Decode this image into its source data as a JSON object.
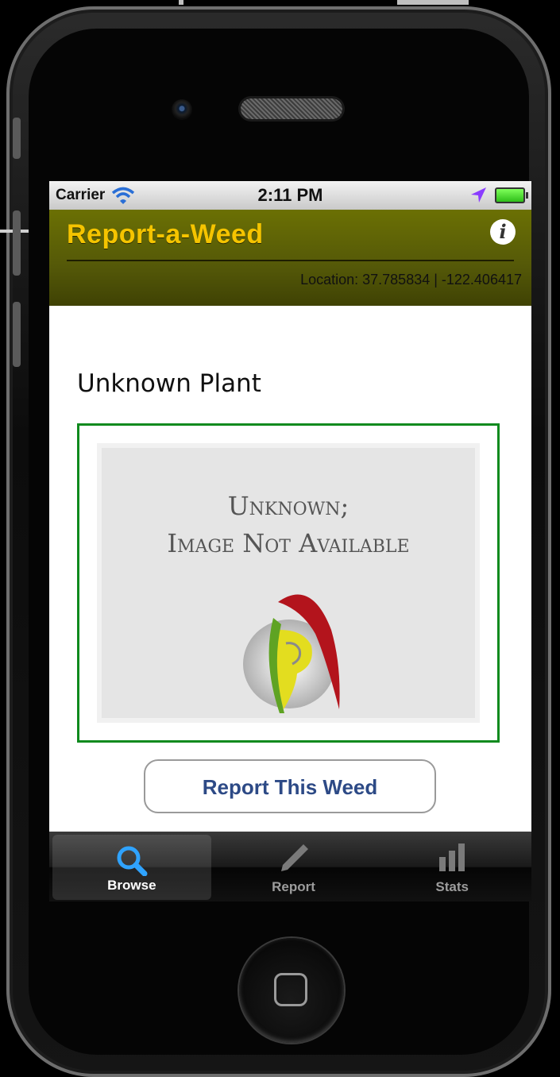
{
  "status_bar": {
    "carrier": "Carrier",
    "time": "2:11 PM",
    "icons": [
      "wifi-icon",
      "location-arrow-icon",
      "battery-icon"
    ]
  },
  "app_bar": {
    "title": "Report-a-Weed",
    "info_icon": "i",
    "location": "Location: 37.785834 | -122.406417"
  },
  "content": {
    "plant_name": "Unknown Plant",
    "image_placeholder": {
      "line1": "Unknown;",
      "line2": "Image Not Available"
    },
    "report_button": "Report This Weed"
  },
  "tabs": [
    {
      "label": "Browse",
      "icon": "search-icon",
      "active": true
    },
    {
      "label": "Report",
      "icon": "pencil-icon",
      "active": false
    },
    {
      "label": "Stats",
      "icon": "bar-chart-icon",
      "active": false
    }
  ],
  "colors": {
    "app_bar": "#545808",
    "title": "#f5c400",
    "frame_border": "#0f8a1e",
    "button_text": "#2d4a86"
  }
}
